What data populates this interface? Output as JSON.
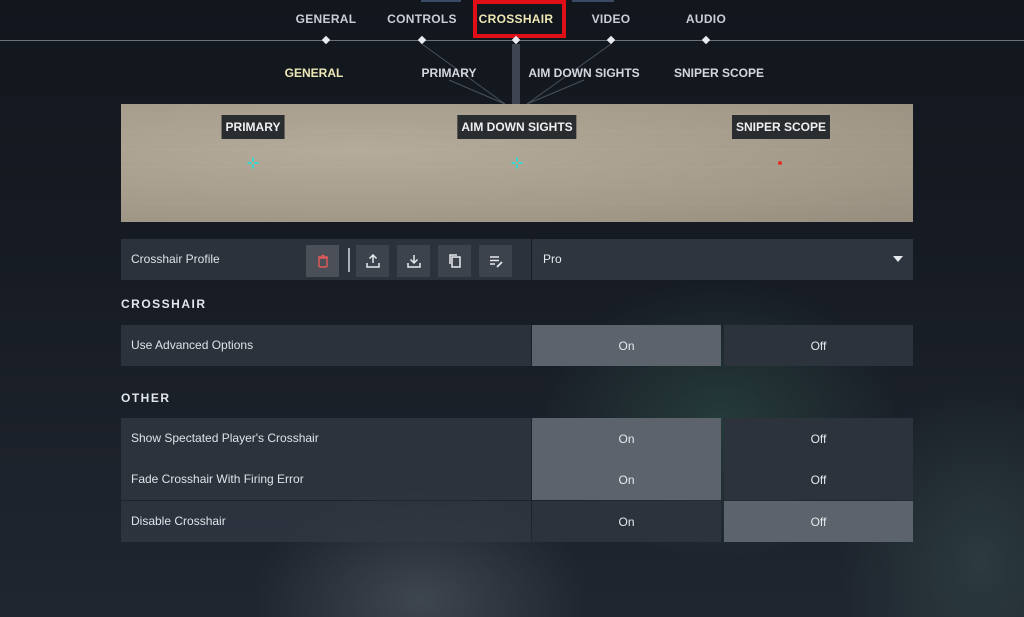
{
  "top_tabs": [
    {
      "label": "GENERAL",
      "active": false
    },
    {
      "label": "CONTROLS",
      "active": false
    },
    {
      "label": "CROSSHAIR",
      "active": true
    },
    {
      "label": "VIDEO",
      "active": false
    },
    {
      "label": "AUDIO",
      "active": false
    }
  ],
  "sub_tabs": [
    {
      "label": "GENERAL",
      "active": true
    },
    {
      "label": "PRIMARY",
      "active": false
    },
    {
      "label": "AIM DOWN SIGHTS",
      "active": false
    },
    {
      "label": "SNIPER SCOPE",
      "active": false
    }
  ],
  "preview": {
    "labels": [
      "PRIMARY",
      "AIM DOWN SIGHTS",
      "SNIPER SCOPE"
    ],
    "crosshair_color_primary": "#3cd7d0",
    "crosshair_color_ads": "#3cd7d0",
    "crosshair_color_sniper": "#e0302a"
  },
  "profile": {
    "label": "Crosshair Profile",
    "selected": "Pro",
    "icons": [
      "trash-icon",
      "upload-icon",
      "download-icon",
      "copy-icon",
      "edit-list-icon"
    ]
  },
  "sections": {
    "crosshair_title": "CROSSHAIR",
    "other_title": "OTHER"
  },
  "settings": {
    "advanced": {
      "label": "Use Advanced Options",
      "on": "On",
      "off": "Off",
      "value": "On"
    },
    "spectated": {
      "label": "Show Spectated Player's Crosshair",
      "on": "On",
      "off": "Off",
      "value": "On"
    },
    "fade": {
      "label": "Fade Crosshair With Firing Error",
      "on": "On",
      "off": "Off",
      "value": "On"
    },
    "disable": {
      "label": "Disable Crosshair",
      "on": "On",
      "off": "Off",
      "value": "Off"
    }
  },
  "colors": {
    "active_tab": "#ede7b5",
    "highlight_box": "#e00e16",
    "selected_option": "#5d636c"
  }
}
